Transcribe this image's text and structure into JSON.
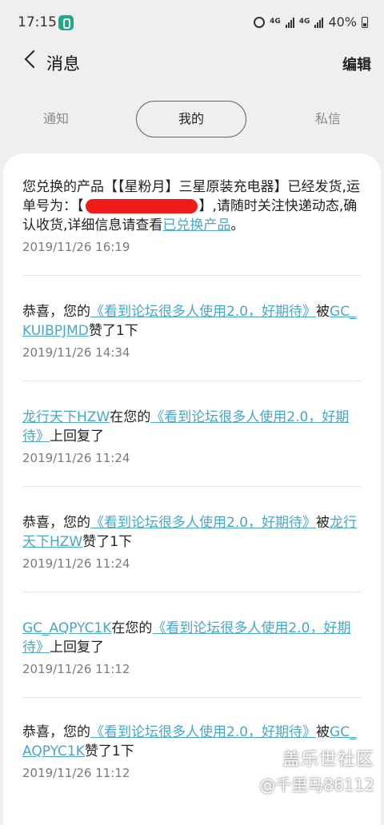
{
  "status_bar": {
    "time": "17:15",
    "battery": "40%",
    "network": "4G"
  },
  "header": {
    "title": "消息",
    "edit": "编辑"
  },
  "tabs": [
    "通知",
    "我的",
    "私信"
  ],
  "messages": [
    {
      "pre": "您兑换的产品【【星粉月】三星原装充电器】已经发货,运单号为：【",
      "mid": "】,请随时关注快递动态,确认收货,详细信息请查看",
      "link": "已兑换产品",
      "post": "。",
      "time": "2019/11/26 16:19"
    },
    {
      "pre": "恭喜，您的",
      "link1": "《看到论坛很多人使用2.0，好期待》",
      "mid": "被",
      "link2": "GC_KUIBPJMD",
      "post": "赞了1下",
      "time": "2019/11/26 14:34"
    },
    {
      "link1": "龙行天下HZW",
      "mid": "在您的",
      "link2": "《看到论坛很多人使用2.0，好期待》",
      "post": "上回复了",
      "time": "2019/11/26 11:24"
    },
    {
      "pre": "恭喜，您的",
      "link1": "《看到论坛很多人使用2.0，好期待》",
      "mid": "被",
      "link2": "龙行天下HZW",
      "post": "赞了1下",
      "time": "2019/11/26 11:24"
    },
    {
      "link1": "GC_AQPYC1K",
      "mid": "在您的",
      "link2": "《看到论坛很多人使用2.0，好期待》",
      "post": "上回复了",
      "time": "2019/11/26 11:12"
    },
    {
      "pre": "恭喜，您的",
      "link1": "《看到论坛很多人使用2.0，好期待》",
      "mid": "被",
      "link2": "GC_AQPYC1K",
      "post": "赞了1下",
      "time": "2019/11/26 11:12"
    }
  ],
  "watermark": {
    "line1": "盖乐世社区",
    "line2": "@千里马86112"
  },
  "colors": {
    "link": "#4aa6c7",
    "background": "#efefef",
    "redaction": "#f11b1b"
  }
}
